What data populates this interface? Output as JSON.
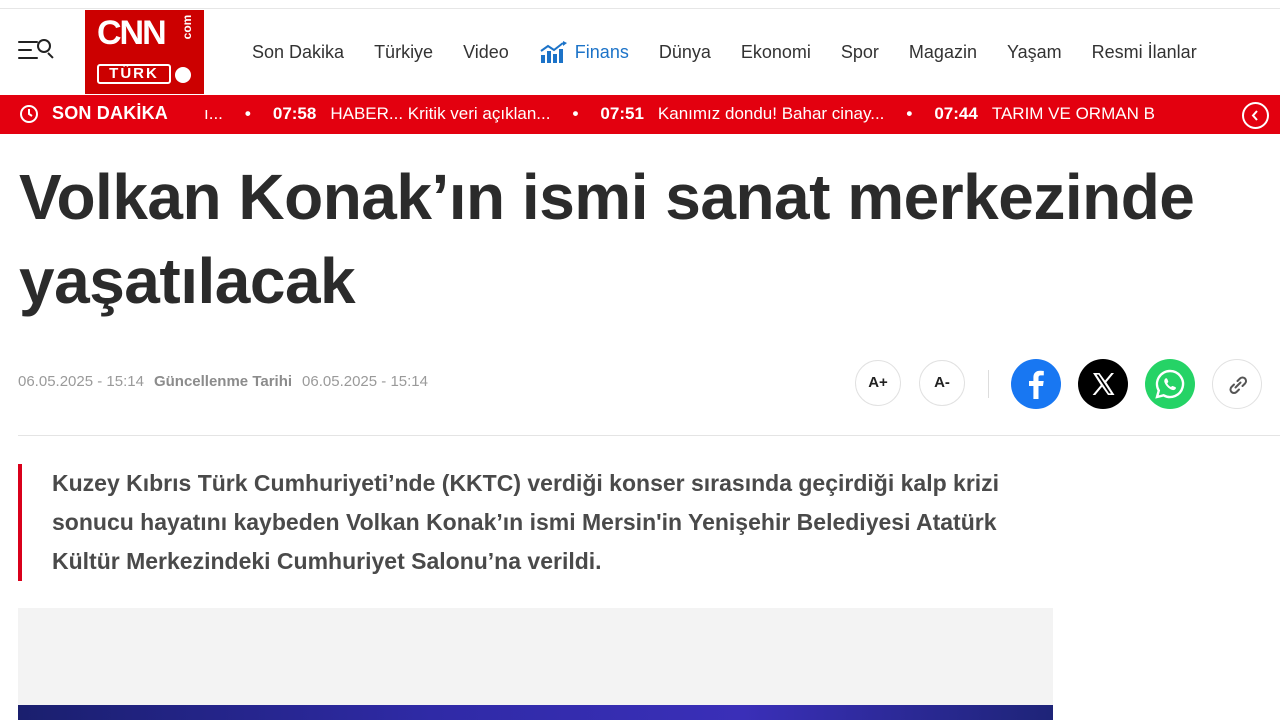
{
  "header": {
    "logo": {
      "cnn": "CNN",
      "com": "com",
      "turk": "TÜRK"
    },
    "nav": [
      {
        "label": "Son Dakika"
      },
      {
        "label": "Türkiye"
      },
      {
        "label": "Video"
      },
      {
        "label": "Finans",
        "icon": "chart-bars-icon",
        "color": "#1c73c8"
      },
      {
        "label": "Dünya"
      },
      {
        "label": "Ekonomi"
      },
      {
        "label": "Spor"
      },
      {
        "label": "Magazin"
      },
      {
        "label": "Yaşam"
      },
      {
        "label": "Resmi İlanlar"
      }
    ]
  },
  "breaking": {
    "label": "SON DAKİKA",
    "lead_fragment": "ı...",
    "items": [
      {
        "time": "07:58",
        "text": "HABER... Kritik veri açıklan..."
      },
      {
        "time": "07:51",
        "text": "Kanımız dondu! Bahar cinay..."
      },
      {
        "time": "07:44",
        "text": "TARIM VE ORMAN B"
      }
    ],
    "bg_color": "#e3000f"
  },
  "article": {
    "title": "Volkan Konak’ın ismi sanat merkezinde yaşatılacak",
    "published": "06.05.2025 - 15:14",
    "updated_label": "Güncellenme Tarihi",
    "updated": "06.05.2025 - 15:14",
    "summary": "Kuzey Kıbrıs Türk Cumhuriyeti’nde (KKTC) verdiği konser sırasında geçirdiği kalp krizi sonucu hayatını kaybeden Volkan Konak’ın ismi Mersin'in Yenişehir Belediyesi Atatürk Kültür Merkezindeki Cumhuriyet Salonu’na verildi."
  },
  "tools": {
    "font_increase": "A+",
    "font_decrease": "A-"
  },
  "share": [
    {
      "icon": "facebook-icon",
      "color": "#1877f2"
    },
    {
      "icon": "x-icon",
      "color": "#000000"
    },
    {
      "icon": "whatsapp-icon",
      "color": "#25d366"
    },
    {
      "icon": "link-icon",
      "color": "#ffffff"
    }
  ]
}
